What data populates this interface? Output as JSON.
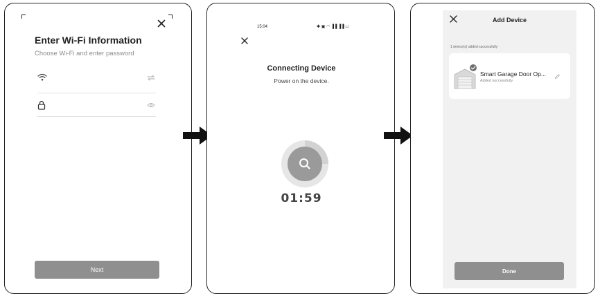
{
  "step1": {
    "title": "Enter Wi-Fi Information",
    "subtitle": "Choose Wi-Fi and enter password",
    "icons": [
      "close-icon",
      "wifi-icon",
      "swap-icon",
      "lock-icon",
      "eye-icon"
    ],
    "next_label": "Next"
  },
  "step2": {
    "status_time": "15:04",
    "status_icons": "✱ ▣ ◠ ▐▐ ▐▐ ▭",
    "title": "Connecting Device",
    "subtitle": "Power on the device.",
    "timer": "01:59",
    "icons": [
      "close-icon",
      "search-icon"
    ]
  },
  "step3": {
    "title": "Add Device",
    "note": "1 device(s) added successfully",
    "device_name": "Smart Garage Door Op...",
    "device_status": "Added successfully",
    "done_label": "Done",
    "icons": [
      "close-icon",
      "garage-door-icon",
      "check-badge-icon",
      "edit-icon"
    ]
  },
  "arrows": [
    "right-arrow-icon",
    "right-arrow-icon"
  ],
  "colors": {
    "button": "#8f8f8f",
    "card_bg": "#f1f1f1",
    "text": "#222222",
    "subtext": "#8c8c8c"
  }
}
